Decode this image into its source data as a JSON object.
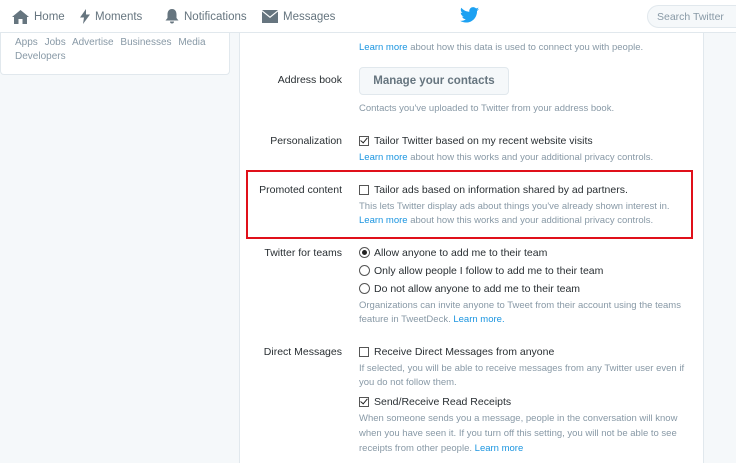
{
  "nav": {
    "home": "Home",
    "moments": "Moments",
    "notifications": "Notifications",
    "messages": "Messages",
    "search_placeholder": "Search Twitter"
  },
  "footer_links": [
    "Apps",
    "Jobs",
    "Advertise",
    "Businesses",
    "Media",
    "Developers"
  ],
  "settings": {
    "top_help_link": "Learn more",
    "top_help_text": " about how this data is used to connect you with people.",
    "address_book": {
      "label": "Address book",
      "button": "Manage your contacts",
      "help": "Contacts you've uploaded to Twitter from your address book."
    },
    "personalization": {
      "label": "Personalization",
      "option": "Tailor Twitter based on my recent website visits",
      "checked": true,
      "help_link": "Learn more",
      "help_text": " about how this works and your additional privacy controls."
    },
    "promoted": {
      "label": "Promoted content",
      "option": "Tailor ads based on information shared by ad partners.",
      "checked": false,
      "help_line1": "This lets Twitter display ads about things you've already shown interest in.",
      "help_link": "Learn more",
      "help_text": " about how this works and your additional privacy controls."
    },
    "teams": {
      "label": "Twitter for teams",
      "options": [
        {
          "text": "Allow anyone to add me to their team",
          "selected": true
        },
        {
          "text": "Only allow people I follow to add me to their team",
          "selected": false
        },
        {
          "text": "Do not allow anyone to add me to their team",
          "selected": false
        }
      ],
      "help_line1": "Organizations can invite anyone to Tweet from their account using the teams",
      "help_line2": "feature in TweetDeck. ",
      "help_link": "Learn more."
    },
    "dm": {
      "label": "Direct Messages",
      "option1": "Receive Direct Messages from anyone",
      "option1_checked": false,
      "help1_line1": "If selected, you will be able to receive messages from any Twitter user even if",
      "help1_line2": "you do not follow them.",
      "option2": "Send/Receive Read Receipts",
      "option2_checked": true,
      "help2_line1": "When someone sends you a message, people in the conversation will know",
      "help2_line2": "when you have seen it. If you turn off this setting, you will not be able to see",
      "help2_line3": "receipts from other people. ",
      "help2_link": "Learn more"
    }
  },
  "colors": {
    "link": "#1b95e0",
    "twitter_blue": "#1da1f2",
    "highlight": "#e0101a"
  }
}
